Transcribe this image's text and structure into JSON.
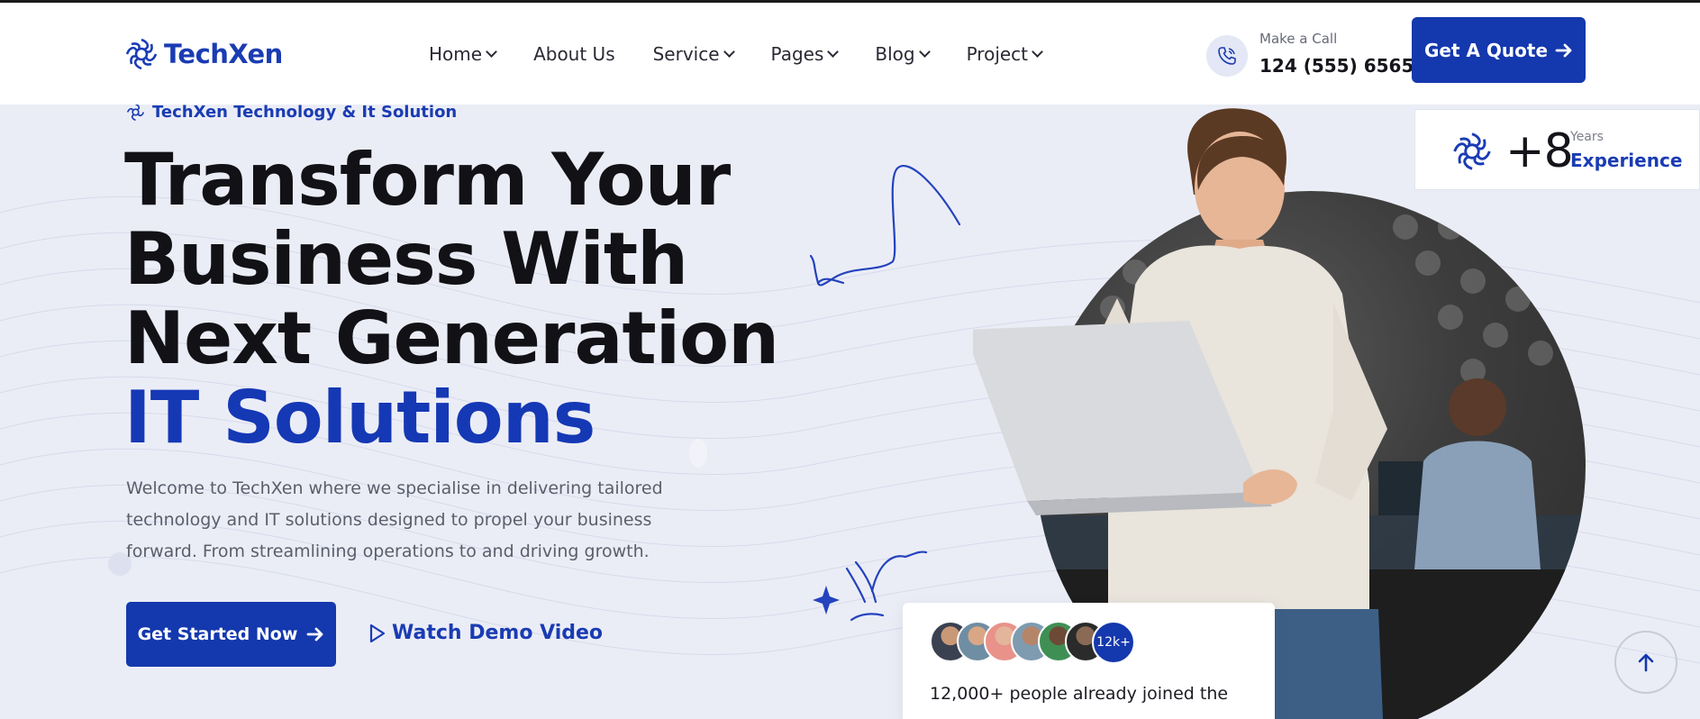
{
  "brand": {
    "name": "TechXen",
    "accent": "#1438ad"
  },
  "nav": [
    {
      "label": "Home",
      "dropdown": true
    },
    {
      "label": "About Us",
      "dropdown": false
    },
    {
      "label": "Service",
      "dropdown": true
    },
    {
      "label": "Pages",
      "dropdown": true
    },
    {
      "label": "Blog",
      "dropdown": true
    },
    {
      "label": "Project",
      "dropdown": true
    }
  ],
  "contact": {
    "caption": "Make a Call",
    "phone": "124 (555) 6565",
    "icon": "phone-icon"
  },
  "header_cta": {
    "label": "Get A Quote",
    "icon": "arrow-right-icon"
  },
  "hero": {
    "tagline": "TechXen Technology & It Solution",
    "headline": [
      "Transform Your",
      "Business With",
      "Next Generation",
      "IT Solutions"
    ],
    "description": "Welcome to TechXen where we specialise in delivering tailored technology and IT solutions designed to propel your business forward. From streamlining operations to and driving growth.",
    "primary_cta": "Get Started Now",
    "secondary_cta": "Watch Demo Video"
  },
  "experience": {
    "value": "+8",
    "caption": "Years",
    "label": "Experience"
  },
  "community": {
    "count_badge": "12k+",
    "text": "12,000+ people already joined the"
  },
  "scroll_top": {
    "icon": "arrow-up-icon"
  }
}
